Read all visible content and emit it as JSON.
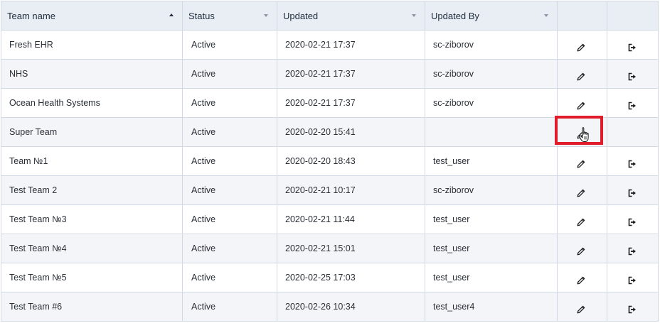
{
  "table": {
    "headers": {
      "name": "Team name",
      "status": "Status",
      "updated": "Updated",
      "updated_by": "Updated By"
    },
    "sort": {
      "column": "name",
      "direction": "ascending"
    },
    "rows": [
      {
        "name": "Fresh EHR",
        "status": "Active",
        "updated": "2020-02-21 17:37",
        "updated_by": "sc-ziborov"
      },
      {
        "name": "NHS",
        "status": "Active",
        "updated": "2020-02-21 17:37",
        "updated_by": "sc-ziborov"
      },
      {
        "name": "Ocean Health Systems",
        "status": "Active",
        "updated": "2020-02-21 17:37",
        "updated_by": "sc-ziborov"
      },
      {
        "name": "Super Team",
        "status": "Active",
        "updated": "2020-02-20 15:41",
        "updated_by": ""
      },
      {
        "name": "Team №1",
        "status": "Active",
        "updated": "2020-02-20 18:43",
        "updated_by": "test_user"
      },
      {
        "name": "Test Team 2",
        "status": "Active",
        "updated": "2020-02-21 10:17",
        "updated_by": "sc-ziborov"
      },
      {
        "name": "Test Team №3",
        "status": "Active",
        "updated": "2020-02-21 11:44",
        "updated_by": "test_user"
      },
      {
        "name": "Test Team №4",
        "status": "Active",
        "updated": "2020-02-21 15:01",
        "updated_by": "test_user"
      },
      {
        "name": "Test Team №5",
        "status": "Active",
        "updated": "2020-02-25 17:03",
        "updated_by": "test_user"
      },
      {
        "name": "Test Team #6",
        "status": "Active",
        "updated": "2020-02-26 10:34",
        "updated_by": "test_user4"
      }
    ],
    "row_actions": {
      "edit_icon": "pencil-icon",
      "leave_icon": "exit-icon"
    }
  },
  "highlight": {
    "color": "#e01b2a",
    "row": "Super Team",
    "target": "edit-button"
  },
  "colors": {
    "header_bg": "#e9edf4",
    "row_alt_bg": "#f3f5f9",
    "border": "#d2d9e4"
  }
}
